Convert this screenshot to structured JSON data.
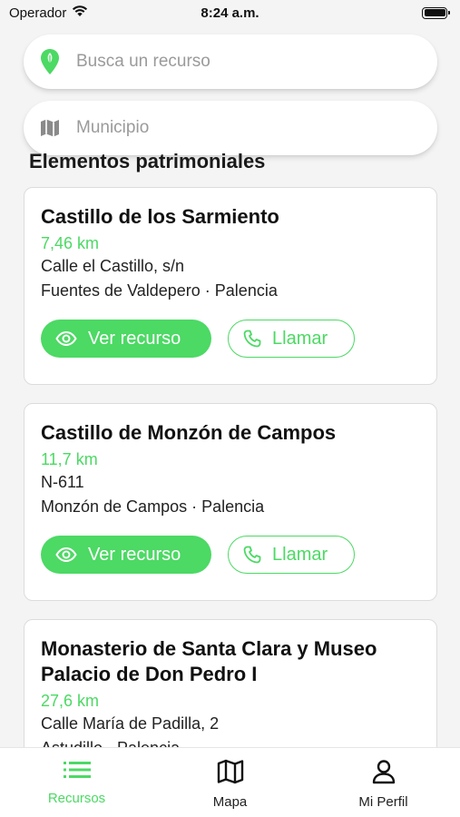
{
  "status_bar": {
    "carrier": "Operador",
    "time": "8:24 a.m."
  },
  "search": {
    "resource_placeholder": "Busca un recurso",
    "municipality_placeholder": "Municipio"
  },
  "section_title": "Elementos patrimoniales",
  "colors": {
    "accent": "#4cd964",
    "text": "#111111",
    "muted": "#9a9a9a"
  },
  "cards": [
    {
      "title": "Castillo de los Sarmiento",
      "distance": "7,46 km",
      "address": "Calle el Castillo, s/n",
      "locality": "Fuentes de Valdepero · Palencia",
      "view_label": "Ver recurso",
      "call_label": "Llamar"
    },
    {
      "title": "Castillo de Monzón de Campos",
      "distance": "11,7 km",
      "address": "N-611",
      "locality": "Monzón de Campos · Palencia",
      "view_label": "Ver recurso",
      "call_label": "Llamar"
    },
    {
      "title": "Monasterio de Santa Clara y Museo Palacio de Don Pedro I",
      "distance": "27,6 km",
      "address": "Calle María de Padilla, 2",
      "locality": "Astudillo · Palencia"
    }
  ],
  "tabs": [
    {
      "label": "Recursos",
      "icon": "list-icon",
      "active": true
    },
    {
      "label": "Mapa",
      "icon": "map-icon",
      "active": false
    },
    {
      "label": "Mi Perfil",
      "icon": "user-icon",
      "active": false
    }
  ]
}
